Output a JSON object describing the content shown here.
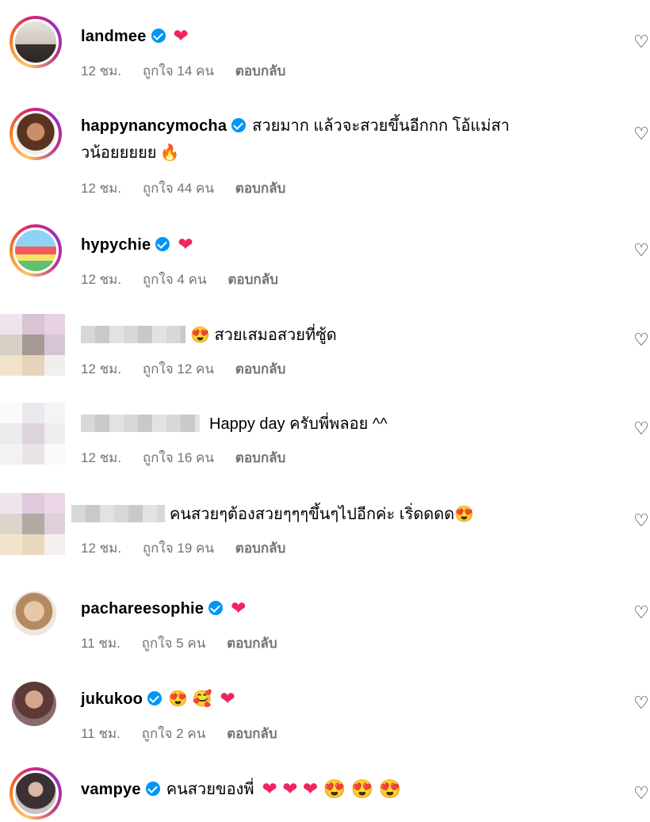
{
  "comments": [
    {
      "username": "landmee",
      "verified": true,
      "text": "",
      "emoji": "❤",
      "time": "12 ชม.",
      "likes": "ถูกใจ 14 คน",
      "reply": "ตอบกลับ"
    },
    {
      "username": "happynancymocha",
      "verified": true,
      "text": "สวยมาก แล้วจะสวยขึ้นอีกกก โอ้แม่สา",
      "text2": "วน้อยยยยย",
      "emoji": "🔥",
      "time": "12 ชม.",
      "likes": "ถูกใจ 44 คน",
      "reply": "ตอบกลับ"
    },
    {
      "username": "hypychie",
      "verified": true,
      "text": "",
      "emoji": "❤",
      "time": "12 ชม.",
      "likes": "ถูกใจ 4 คน",
      "reply": "ตอบกลับ"
    },
    {
      "username": "",
      "verified": false,
      "text": "😍 สวยเสมอสวยที่ซู้ด",
      "time": "12 ชม.",
      "likes": "ถูกใจ 12 คน",
      "reply": "ตอบกลับ"
    },
    {
      "username": "",
      "verified": false,
      "text": "Happy day ครับพี่พลอย ^^",
      "time": "12 ชม.",
      "likes": "ถูกใจ 16 คน",
      "reply": "ตอบกลับ"
    },
    {
      "username": "",
      "verified": false,
      "text": "คนสวยๆต้องสวยๆๆๆขึ้นๆไปอีกค่ะ เริ่ดดดด😍",
      "time": "12 ชม.",
      "likes": "ถูกใจ 19 คน",
      "reply": "ตอบกลับ"
    },
    {
      "username": "pachareesophie",
      "verified": true,
      "text": "",
      "emoji": "❤",
      "time": "11 ชม.",
      "likes": "ถูกใจ 5 คน",
      "reply": "ตอบกลับ"
    },
    {
      "username": "jukukoo",
      "verified": true,
      "text": "😍 🥰",
      "emoji": "❤",
      "time": "11 ชม.",
      "likes": "ถูกใจ 2 คน",
      "reply": "ตอบกลับ"
    },
    {
      "username": "vampye",
      "verified": true,
      "text": "คนสวยของพี่",
      "emoji": "❤ ❤ ❤ 😍 😍 😍",
      "time": "",
      "likes": "",
      "reply": ""
    }
  ],
  "icons": {
    "like": "heart-outline-icon",
    "verified": "verified-badge-icon"
  },
  "colors": {
    "verified": "#0095f6",
    "heart": "#f0245e",
    "meta": "#737373"
  }
}
